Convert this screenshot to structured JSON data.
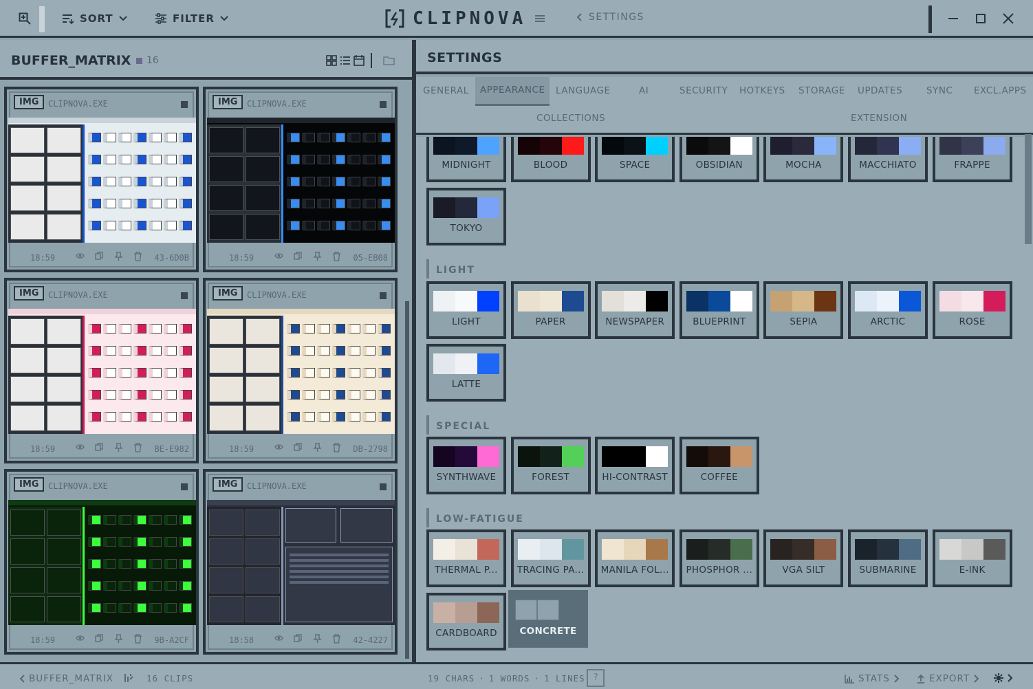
{
  "titlebar": {
    "app_name": "CLIPNOVA",
    "sort_label": "SORT",
    "filter_label": "FILTER",
    "breadcrumb": "SETTINGS"
  },
  "buffer": {
    "title": "BUFFER_MATRIX",
    "count": "16",
    "clips": [
      {
        "badge": "IMG",
        "source": "CLIPNOVA.EXE",
        "time": "18:59",
        "hash": "43-6D0B",
        "theme": "light"
      },
      {
        "badge": "IMG",
        "source": "CLIPNOVA.EXE",
        "time": "18:59",
        "hash": "05-EB08",
        "theme": "dark"
      },
      {
        "badge": "IMG",
        "source": "CLIPNOVA.EXE",
        "time": "18:59",
        "hash": "BE-E982",
        "theme": "rose"
      },
      {
        "badge": "IMG",
        "source": "CLIPNOVA.EXE",
        "time": "18:59",
        "hash": "DB-2798",
        "theme": "paper"
      },
      {
        "badge": "IMG",
        "source": "CLIPNOVA.EXE",
        "time": "18:59",
        "hash": "9B-A2CF",
        "theme": "phosphor"
      },
      {
        "badge": "IMG",
        "source": "CLIPNOVA.EXE",
        "time": "18:58",
        "hash": "42-4227",
        "theme": "slate"
      }
    ]
  },
  "settings": {
    "title": "SETTINGS",
    "tabs": [
      "GENERAL",
      "APPEARANCE",
      "LANGUAGE",
      "AI",
      "SECURITY",
      "HOTKEYS",
      "STORAGE",
      "UPDATES",
      "SYNC",
      "EXCL.APPS",
      "COLLECTIONS",
      "EXTENSION"
    ],
    "active_tab": "APPEARANCE",
    "categories": {
      "dark": [
        {
          "name": "MIDNIGHT",
          "colors": [
            "#0b1420",
            "#0e1a2a",
            "#4da3ff"
          ]
        },
        {
          "name": "BLOOD",
          "colors": [
            "#160305",
            "#26050a",
            "#ff1a1a"
          ]
        },
        {
          "name": "SPACE",
          "colors": [
            "#05080d",
            "#0a1218",
            "#00d0ff"
          ]
        },
        {
          "name": "OBSIDIAN",
          "colors": [
            "#0b0b0b",
            "#141414",
            "#ffffff"
          ]
        },
        {
          "name": "MOCHA",
          "colors": [
            "#1e1e2e",
            "#2a2a3c",
            "#89b4fa"
          ]
        },
        {
          "name": "MACCHIATO",
          "colors": [
            "#24273a",
            "#313450",
            "#8aadf4"
          ]
        },
        {
          "name": "FRAPPE",
          "colors": [
            "#303446",
            "#3c4159",
            "#8caaee"
          ]
        },
        {
          "name": "TOKYO",
          "colors": [
            "#1a1b26",
            "#24283b",
            "#7aa2f7"
          ]
        }
      ],
      "light_label": "LIGHT",
      "light": [
        {
          "name": "LIGHT",
          "colors": [
            "#eef2f5",
            "#f7f9fb",
            "#0040ff"
          ]
        },
        {
          "name": "PAPER",
          "colors": [
            "#e9e0d0",
            "#efe7d5",
            "#1e4a92"
          ]
        },
        {
          "name": "NEWSPAPER",
          "colors": [
            "#e3e0da",
            "#ecebe7",
            "#000000"
          ]
        },
        {
          "name": "BLUEPRINT",
          "colors": [
            "#0a3264",
            "#0b4a9a",
            "#ffffff"
          ]
        },
        {
          "name": "SEPIA",
          "colors": [
            "#c6a273",
            "#d5b788",
            "#6b3412"
          ]
        },
        {
          "name": "ARCTIC",
          "colors": [
            "#dde8f5",
            "#edf3fa",
            "#0a58d8"
          ]
        },
        {
          "name": "ROSE",
          "colors": [
            "#f3dde2",
            "#f8e8ec",
            "#d41c5a"
          ]
        },
        {
          "name": "LATTE",
          "colors": [
            "#e3e7ee",
            "#eff1f5",
            "#1e66f5"
          ]
        }
      ],
      "special_label": "SPECIAL",
      "special": [
        {
          "name": "SYNTHWAVE",
          "colors": [
            "#160423",
            "#240a39",
            "#ff6ad5"
          ]
        },
        {
          "name": "FOREST",
          "colors": [
            "#0a140c",
            "#12221a",
            "#52d057"
          ]
        },
        {
          "name": "HI-CONTRAST",
          "colors": [
            "#000000",
            "#000000",
            "#ffffff"
          ]
        },
        {
          "name": "COFFEE",
          "colors": [
            "#140c08",
            "#2a1810",
            "#c8946a"
          ]
        }
      ],
      "lowfatigue_label": "LOW-FATIGUE",
      "lowfatigue": [
        {
          "name": "THERMAL P...",
          "colors": [
            "#f4efe6",
            "#e9e2d7",
            "#c2675a"
          ]
        },
        {
          "name": "TRACING PA...",
          "colors": [
            "#e8eef2",
            "#dde6ec",
            "#62969e"
          ]
        },
        {
          "name": "MANILA FOL...",
          "colors": [
            "#f0e5d0",
            "#e6d6ba",
            "#a8784a"
          ]
        },
        {
          "name": "PHOSPHOR ...",
          "colors": [
            "#1a1e1c",
            "#262c28",
            "#4a6e4c"
          ]
        },
        {
          "name": "VGA SILT",
          "colors": [
            "#282220",
            "#362c28",
            "#8c5c44"
          ]
        },
        {
          "name": "SUBMARINE",
          "colors": [
            "#1a232c",
            "#25313c",
            "#4e6c84"
          ]
        },
        {
          "name": "E-INK",
          "colors": [
            "#d8d8d6",
            "#c8c8c6",
            "#5a5a58"
          ]
        },
        {
          "name": "CARDBOARD",
          "colors": [
            "#c9b0a4",
            "#b89e92",
            "#8c6656"
          ]
        },
        {
          "name": "CONCRETE",
          "colors": [
            "#8fa3ad",
            "#9aadb7"
          ],
          "selected": true
        }
      ]
    }
  },
  "status": {
    "left_breadcrumb": "BUFFER_MATRIX",
    "clips": "16 CLIPS",
    "chars": "19 CHARS",
    "words": "1 WORDS",
    "lines": "1 LINES",
    "sep": "·",
    "help": "?",
    "stats": "STATS",
    "export": "EXPORT"
  },
  "colors": {
    "frame": "#2a353e",
    "bg": "#8fa3ad",
    "panel": "#9aadb7",
    "accent": "#5a6e7a"
  }
}
